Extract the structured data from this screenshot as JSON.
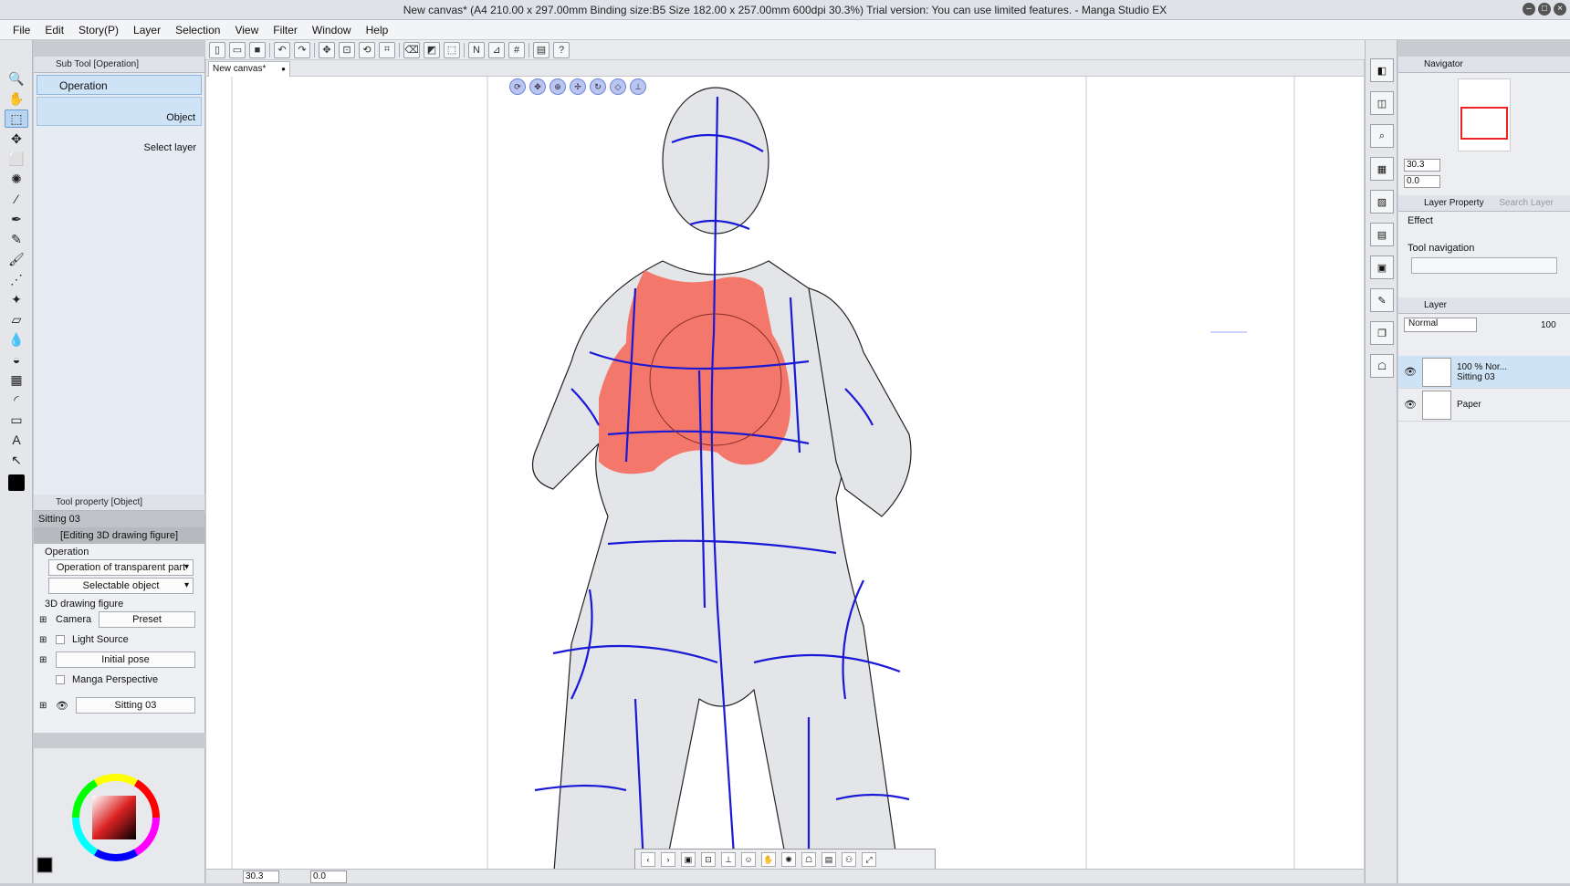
{
  "window": {
    "title": "New canvas* (A4 210.00 x 297.00mm Binding size:B5 Size 182.00 x 257.00mm 600dpi 30.3%)  Trial version: You can use limited features. - Manga Studio EX"
  },
  "menu": [
    "File",
    "Edit",
    "Story(P)",
    "Layer",
    "Selection",
    "View",
    "Filter",
    "Window",
    "Help"
  ],
  "tab": {
    "label": "New canvas*"
  },
  "subtool": {
    "header": "Sub Tool [Operation]",
    "group": "Operation",
    "items": [
      "Object",
      "Select layer"
    ]
  },
  "toolprop": {
    "header": "Tool property [Object]",
    "name": "Sitting 03",
    "editing": "[Editing 3D drawing figure]",
    "operation_label": "Operation",
    "op_transparent": "Operation of transparent part",
    "selectable": "Selectable object",
    "figure_label": "3D drawing figure",
    "camera": "Camera",
    "preset": "Preset",
    "light": "Light Source",
    "initial_pose": "Initial pose",
    "manga_persp": "Manga Perspective",
    "sitting": "Sitting 03"
  },
  "navigator": {
    "header": "Navigator",
    "zoom": "30.3",
    "angle": "0.0"
  },
  "layerprop": {
    "header": "Layer Property",
    "search": "Search Layer",
    "effect": "Effect",
    "toolnav": "Tool navigation"
  },
  "layers": {
    "header": "Layer",
    "blend": "Normal",
    "opacity": "100",
    "items": [
      {
        "opacity": "100 %",
        "mode": "Nor...",
        "name": "Sitting 03"
      },
      {
        "name": "Paper"
      }
    ]
  },
  "status": {
    "zoom": "30.3",
    "angle": "0.0"
  },
  "colors": {
    "accent": "#b8d4f0",
    "figure": "#e2e4e8",
    "guides": "#1a1ad6",
    "highlight": "#f26a5c"
  }
}
